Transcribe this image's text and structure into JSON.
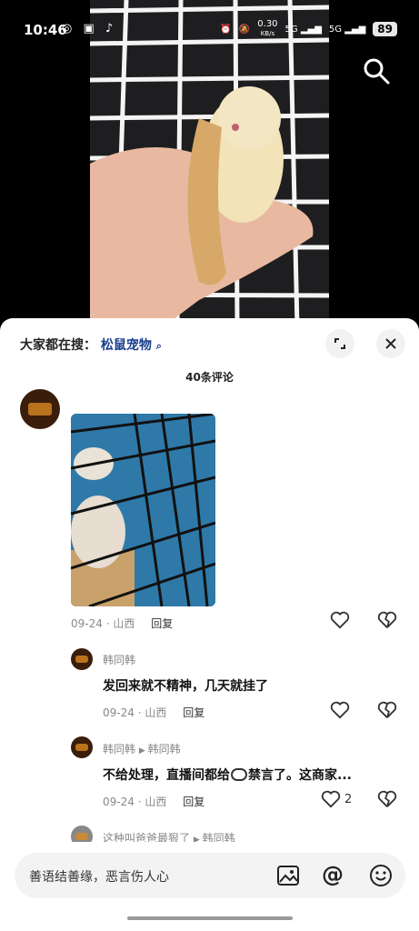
{
  "status_bar": {
    "time": "10:46",
    "net_speed": "0.30",
    "net_unit": "KB/s",
    "sig1": "5G",
    "sig2": "5G",
    "battery": "89"
  },
  "sheet": {
    "hot_search_prefix": "大家都在搜：",
    "hot_search_keyword": "松鼠宠物",
    "comment_count": "40条评论"
  },
  "comments": [
    {
      "date": "09-24",
      "location": "山西",
      "reply_label": "回复"
    },
    {
      "author": "韩同韩",
      "text": "发回来就不精神，几天就挂了",
      "date": "09-24",
      "location": "山西",
      "reply_label": "回复"
    },
    {
      "author": "韩同韩",
      "reply_to": "韩同韩",
      "text_a": "不给处理，直播间都给",
      "text_b": "禁言了。这商家...",
      "date": "09-24",
      "location": "山西",
      "reply_label": "回复",
      "like_count": "2"
    },
    {
      "author": "这种叫爸爸最狠了",
      "reply_to": "韩同韩"
    }
  ],
  "input": {
    "placeholder": "善语结善缘，恶言伤人心"
  },
  "icons": {
    "search": "search-icon",
    "expand": "expand-icon",
    "close": "close-icon",
    "heart": "heart-icon",
    "broken_heart": "broken-heart-icon",
    "image": "image-icon",
    "at": "at-icon",
    "emoji": "emoji-icon"
  }
}
